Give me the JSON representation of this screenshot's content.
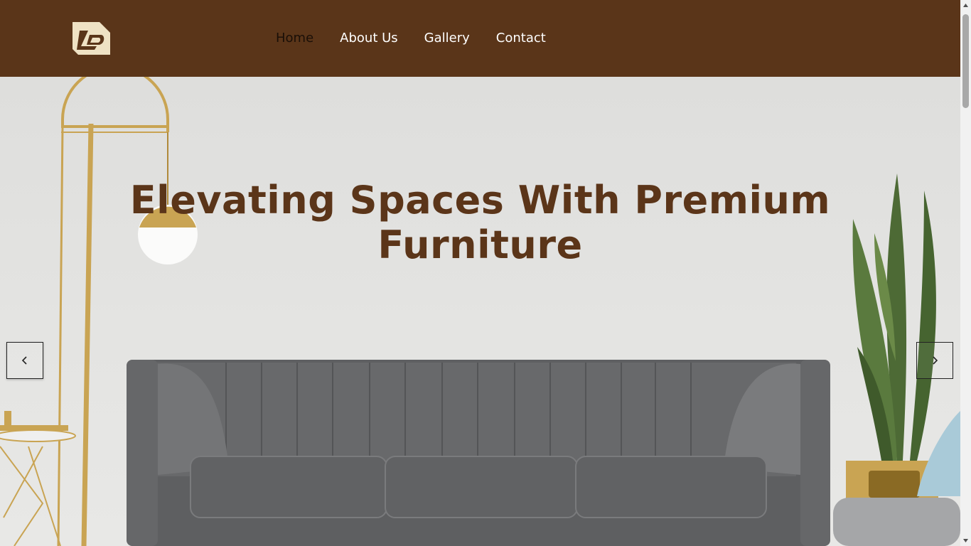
{
  "header": {
    "logo_icon": "brand-monogram-logo",
    "nav": [
      {
        "label": "Home",
        "active": true
      },
      {
        "label": "About Us",
        "active": false
      },
      {
        "label": "Gallery",
        "active": false
      },
      {
        "label": "Contact",
        "active": false
      }
    ]
  },
  "hero": {
    "headline_line1": "Elevating Spaces With Premium",
    "headline_line2": "Furniture",
    "prev_icon": "chevron-left-icon",
    "next_icon": "chevron-right-icon"
  },
  "colors": {
    "header_bg": "#5a3519",
    "headline": "#5b3519",
    "nav_text": "#ffffff",
    "nav_active": "#1a0f07"
  }
}
